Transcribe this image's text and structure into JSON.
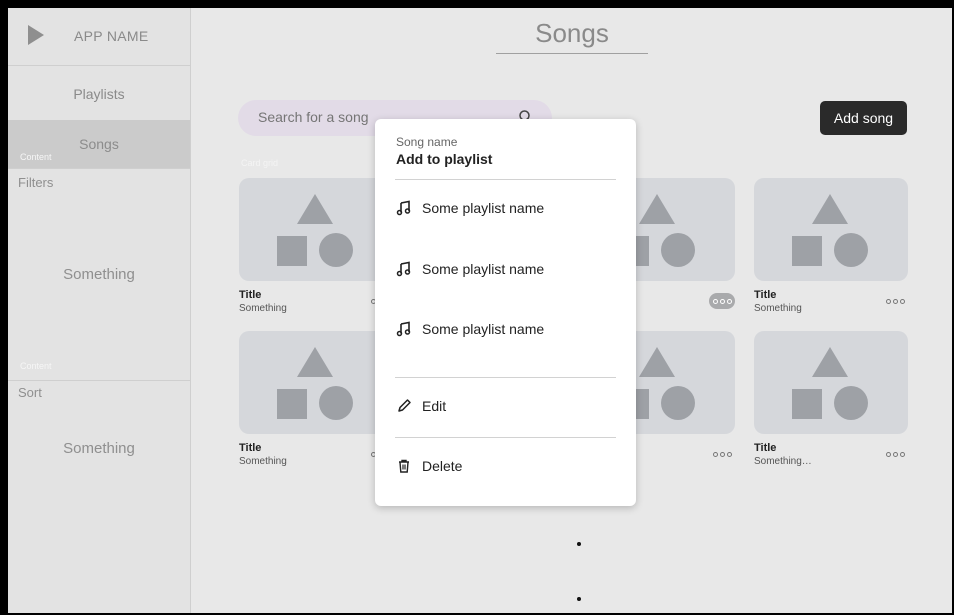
{
  "sidebar": {
    "app_name": "APP NAME",
    "nav": [
      {
        "label": "Playlists"
      },
      {
        "label": "Songs"
      }
    ],
    "content_tag_1": "Content",
    "filters_label": "Filters",
    "filters_value": "Something",
    "content_tag_2": "Content",
    "sort_label": "Sort",
    "sort_value": "Something"
  },
  "main": {
    "title": "Songs",
    "search": {
      "placeholder": "Search for a song"
    },
    "add_song_label": "Add song",
    "card_grid_label": "Card grid",
    "cards": [
      {
        "title": "Title",
        "subtitle": "Something"
      },
      {
        "title": "Title",
        "subtitle": "Something"
      },
      {
        "title": "Title",
        "subtitle": "Something"
      },
      {
        "title": "Title",
        "subtitle": "Something…"
      }
    ]
  },
  "menu": {
    "song_name": "Song name",
    "add_to_playlist": "Add to playlist",
    "playlists": [
      "Some playlist name",
      "Some playlist name",
      "Some playlist name"
    ],
    "edit_label": "Edit",
    "delete_label": "Delete"
  },
  "icons": [
    "play-icon",
    "search-icon",
    "music-note-icon",
    "pencil-icon",
    "trash-icon",
    "more-icon"
  ]
}
